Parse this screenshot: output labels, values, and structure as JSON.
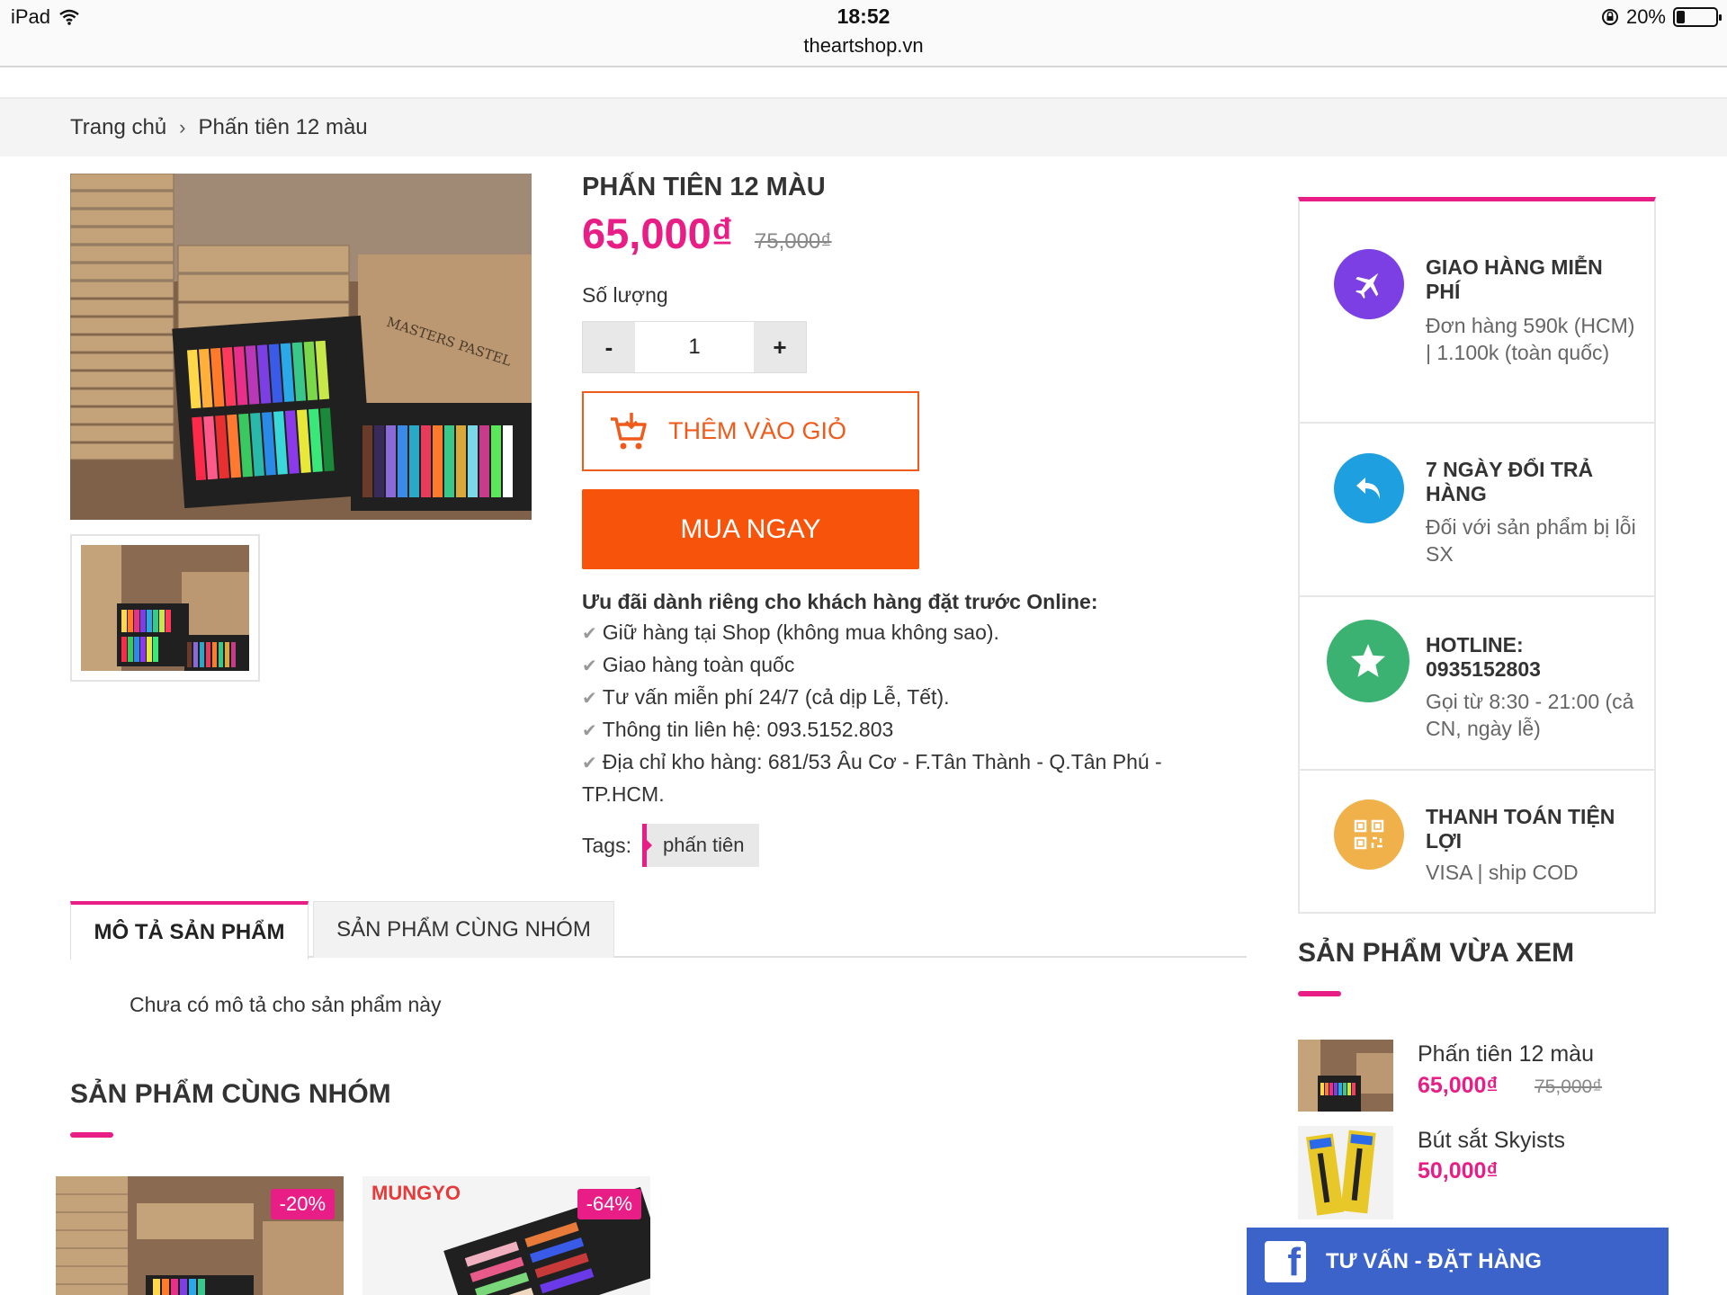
{
  "status_bar": {
    "device": "iPad",
    "time": "18:52",
    "url": "theartshop.vn",
    "battery": "20%"
  },
  "breadcrumb": {
    "home": "Trang chủ",
    "current": "Phấn tiên 12 màu"
  },
  "product": {
    "title": "PHẤN TIÊN 12 MÀU",
    "price": "65,000₫",
    "old_price": "75,000₫",
    "qty_label": "Số lượng",
    "qty_minus": "-",
    "qty_value": "1",
    "qty_plus": "+",
    "add_to_cart": "THÊM VÀO GIỎ",
    "buy_now": "MUA NGAY",
    "offers_head": "Ưu đãi dành riêng cho khách hàng đặt trước Online:",
    "offers": [
      "Giữ hàng tại Shop (không mua không sao).",
      "Giao hàng toàn quốc",
      "Tư vấn miễn phí 24/7 (cả dịp Lễ, Tết).",
      "Thông tin liên hệ: 093.5152.803",
      "Địa chỉ kho hàng: 681/53 Âu Cơ - F.Tân Thành - Q.Tân Phú - TP.HCM."
    ],
    "tags_label": "Tags:",
    "tag": "phấn tiên",
    "box_label": "MASTERS PASTEL"
  },
  "tabs": {
    "description": "MÔ TẢ SẢN PHẨM",
    "related": "SẢN PHẨM CÙNG NHÓM"
  },
  "description_text": "Chưa có mô tả cho sản phẩm này",
  "related": {
    "title": "SẢN PHẨM CÙNG NHÓM",
    "cards": [
      {
        "badge": "-20%"
      },
      {
        "badge": "-64%",
        "brand": "MUNGYO"
      }
    ]
  },
  "benefits": [
    {
      "title": "GIAO HÀNG MIỄN PHÍ",
      "sub": "Đơn hàng 590k (HCM) | 1.100k (toàn quốc)",
      "color": "#7b3fe4",
      "icon": "airplane-icon"
    },
    {
      "title": "7 NGÀY ĐỔI TRẢ HÀNG",
      "sub": "Đối với sản phẩm bị lỗi SX",
      "color": "#1e9fe0",
      "icon": "return-icon"
    },
    {
      "title": "HOTLINE: 0935152803",
      "sub": "Gọi từ 8:30 - 21:00 (cả CN, ngày lễ)",
      "color": "#3bb272",
      "icon": "star-icon"
    },
    {
      "title": "THANH TOÁN TIỆN LỢI",
      "sub": "VISA | ship COD",
      "color": "#f0b04a",
      "icon": "qr-icon"
    }
  ],
  "recent": {
    "title": "SẢN PHẨM VỪA XEM",
    "items": [
      {
        "name": "Phấn tiên 12 màu",
        "price": "65,000₫",
        "old_price": "75,000₫"
      },
      {
        "name": "Bút sắt Skyists",
        "price": "50,000₫"
      }
    ]
  },
  "fb_bar": {
    "label": "TƯ VẤN - ĐẶT HÀNG"
  },
  "colors": {
    "accent": "#e81d85",
    "buy": "#f8530b",
    "facebook": "#3b63c9"
  }
}
